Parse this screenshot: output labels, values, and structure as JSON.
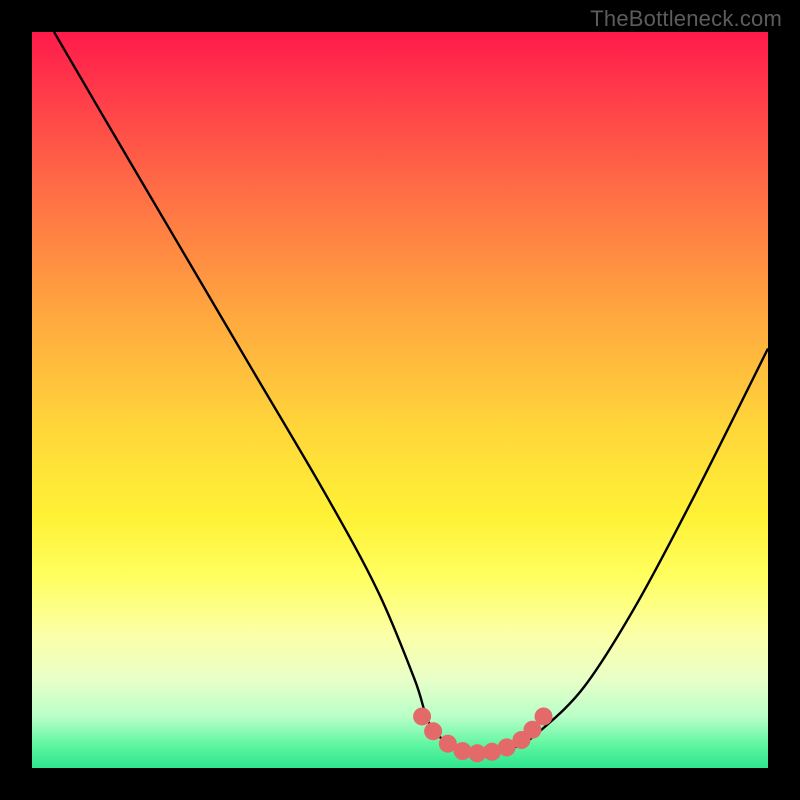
{
  "watermark": "TheBottleneck.com",
  "chart_data": {
    "type": "line",
    "title": "",
    "xlabel": "",
    "ylabel": "",
    "xlim": [
      0,
      100
    ],
    "ylim": [
      0,
      100
    ],
    "grid": false,
    "legend": false,
    "series": [
      {
        "name": "curve",
        "x": [
          3,
          10,
          20,
          30,
          40,
          47,
          52,
          54,
          57,
          60,
          63,
          66,
          69,
          75,
          82,
          90,
          100
        ],
        "y": [
          100,
          88,
          71,
          54,
          37,
          24,
          12,
          6,
          3,
          2,
          2,
          3,
          5,
          11,
          22,
          37,
          57
        ],
        "stroke": "#000000",
        "stroke_width": 2.4
      },
      {
        "name": "dots",
        "type": "scatter",
        "points": [
          {
            "x": 53.0,
            "y": 7.0
          },
          {
            "x": 54.5,
            "y": 5.0
          },
          {
            "x": 56.5,
            "y": 3.3
          },
          {
            "x": 58.5,
            "y": 2.3
          },
          {
            "x": 60.5,
            "y": 2.0
          },
          {
            "x": 62.5,
            "y": 2.2
          },
          {
            "x": 64.5,
            "y": 2.8
          },
          {
            "x": 66.5,
            "y": 3.8
          },
          {
            "x": 68.0,
            "y": 5.2
          },
          {
            "x": 69.5,
            "y": 7.0
          }
        ],
        "color": "#e46a6a",
        "radius": 9
      }
    ]
  }
}
